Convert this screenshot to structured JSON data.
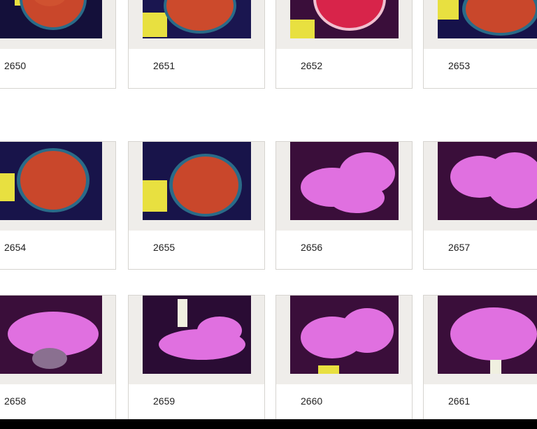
{
  "gallery": {
    "items": [
      {
        "id": "2650",
        "theme": "red"
      },
      {
        "id": "2651",
        "theme": "red"
      },
      {
        "id": "2652",
        "theme": "rose"
      },
      {
        "id": "2653",
        "theme": "red"
      },
      {
        "id": "2654",
        "theme": "red"
      },
      {
        "id": "2655",
        "theme": "red"
      },
      {
        "id": "2656",
        "theme": "pink"
      },
      {
        "id": "2657",
        "theme": "pink"
      },
      {
        "id": "2658",
        "theme": "pink"
      },
      {
        "id": "2659",
        "theme": "pink"
      },
      {
        "id": "2660",
        "theme": "pink"
      },
      {
        "id": "2661",
        "theme": "pink"
      }
    ]
  },
  "colors": {
    "frame": "#efedea",
    "red_coral": "#c9472b",
    "pink_coral": "#e070e0",
    "tank_blue": "#1c1860",
    "tank_purple": "#3a0e3a"
  }
}
